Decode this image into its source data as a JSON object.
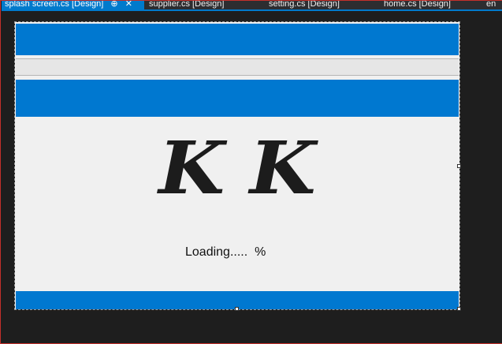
{
  "tabs": [
    {
      "label": "splash screen.cs [Design]",
      "active": true,
      "pin_icon": "pin-icon",
      "close_icon": "close-icon"
    },
    {
      "label": "supplier.cs [Design]",
      "active": false
    },
    {
      "label": "setting.cs [Design]",
      "active": false
    },
    {
      "label": "home.cs [Design]",
      "active": false
    },
    {
      "label": "en",
      "active": false
    }
  ],
  "icons": {
    "pin": "⊕",
    "close": "✕"
  },
  "splash": {
    "logo_text": "KK",
    "loading_text": "Loading.....  %"
  },
  "colors": {
    "accent_blue": "#0078d0",
    "tab_active": "#007acc",
    "background": "#1e1e1e",
    "form_background": "#f0f0f0"
  }
}
